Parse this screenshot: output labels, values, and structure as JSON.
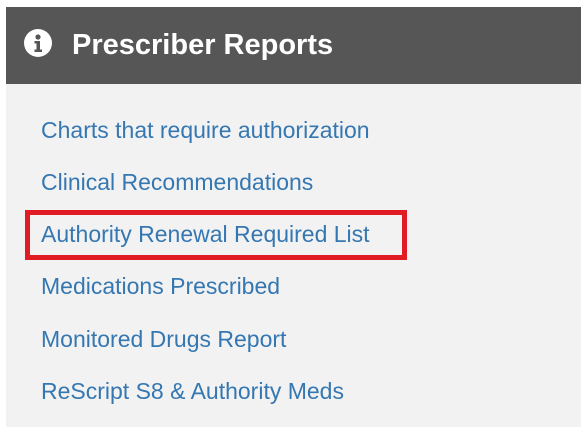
{
  "panel": {
    "title": "Prescriber Reports",
    "icon": "info-circle-icon",
    "header_color": "#565656",
    "body_color": "#f2f2f2",
    "link_color": "#3577b1",
    "highlight_color": "#e01b24"
  },
  "reports": [
    {
      "label": "Charts that require authorization"
    },
    {
      "label": "Clinical Recommendations"
    },
    {
      "label": "Authority Renewal Required List",
      "highlighted": true
    },
    {
      "label": "Medications Prescribed"
    },
    {
      "label": "Monitored Drugs Report"
    },
    {
      "label": "ReScript S8 & Authority Meds"
    }
  ]
}
